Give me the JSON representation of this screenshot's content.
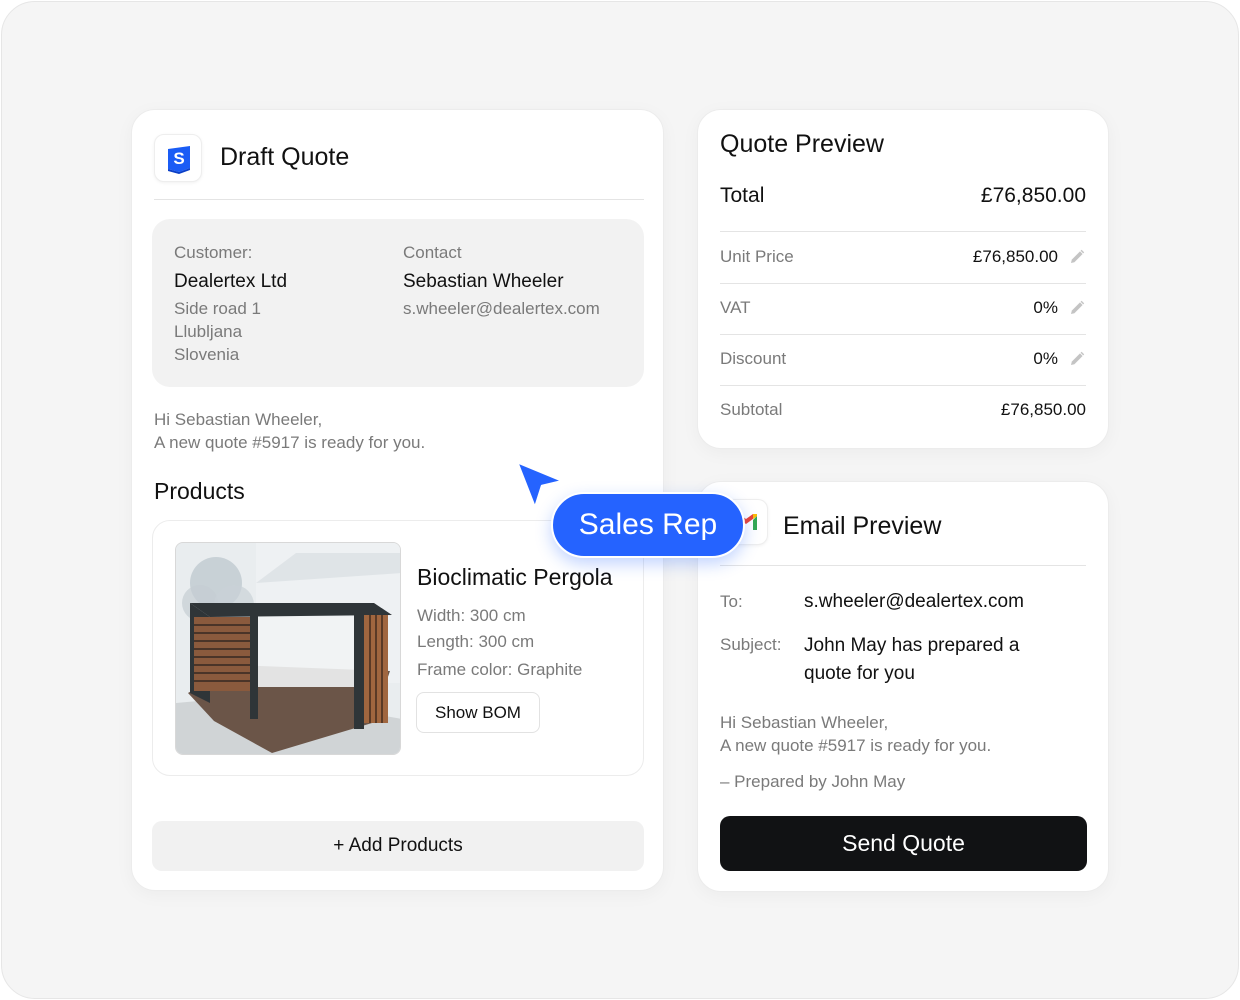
{
  "draft_quote": {
    "title": "Draft Quote",
    "customer": {
      "label": "Customer:",
      "name": "Dealertex Ltd",
      "address": [
        "Side road 1",
        "Llubljana",
        "Slovenia"
      ]
    },
    "contact": {
      "label": "Contact",
      "name": "Sebastian Wheeler",
      "email": "s.wheeler@dealertex.com"
    },
    "greeting": [
      "Hi Sebastian Wheeler,",
      "A new quote #5917 is ready for you."
    ],
    "products_title": "Products",
    "product": {
      "name": "Bioclimatic Pergola",
      "specs": [
        "Width: 300 cm",
        "Length: 300 cm",
        "Frame color: Graphite"
      ],
      "bom_button": "Show BOM"
    },
    "add_products_button": "+ Add Products"
  },
  "quote_preview": {
    "title": "Quote Preview",
    "total_label": "Total",
    "total_value": "£76,850.00",
    "rows": [
      {
        "label": "Unit Price",
        "value": "£76,850.00"
      },
      {
        "label": "VAT",
        "value": "0%"
      },
      {
        "label": "Discount",
        "value": "0%"
      },
      {
        "label": "Subtotal",
        "value": "£76,850.00"
      }
    ]
  },
  "email_preview": {
    "title": "Email Preview",
    "to_label": "To:",
    "to_value": "s.wheeler@dealertex.com",
    "subject_label": "Subject:",
    "subject_value": "John May has prepared a quote for you",
    "body": [
      "Hi Sebastian Wheeler,",
      "A new quote #5917 is ready for you."
    ],
    "signature": "– Prepared by John May",
    "send_button": "Send Quote"
  },
  "cursor_badge": "Sales Rep",
  "icons": {
    "app_logo": "s-logo-icon",
    "email_logo": "gmail-icon",
    "edit": "pencil-icon",
    "cursor": "cursor-arrow-icon"
  },
  "colors": {
    "accent": "#2563ff",
    "send_button": "#111214",
    "background": "#f5f5f5"
  }
}
